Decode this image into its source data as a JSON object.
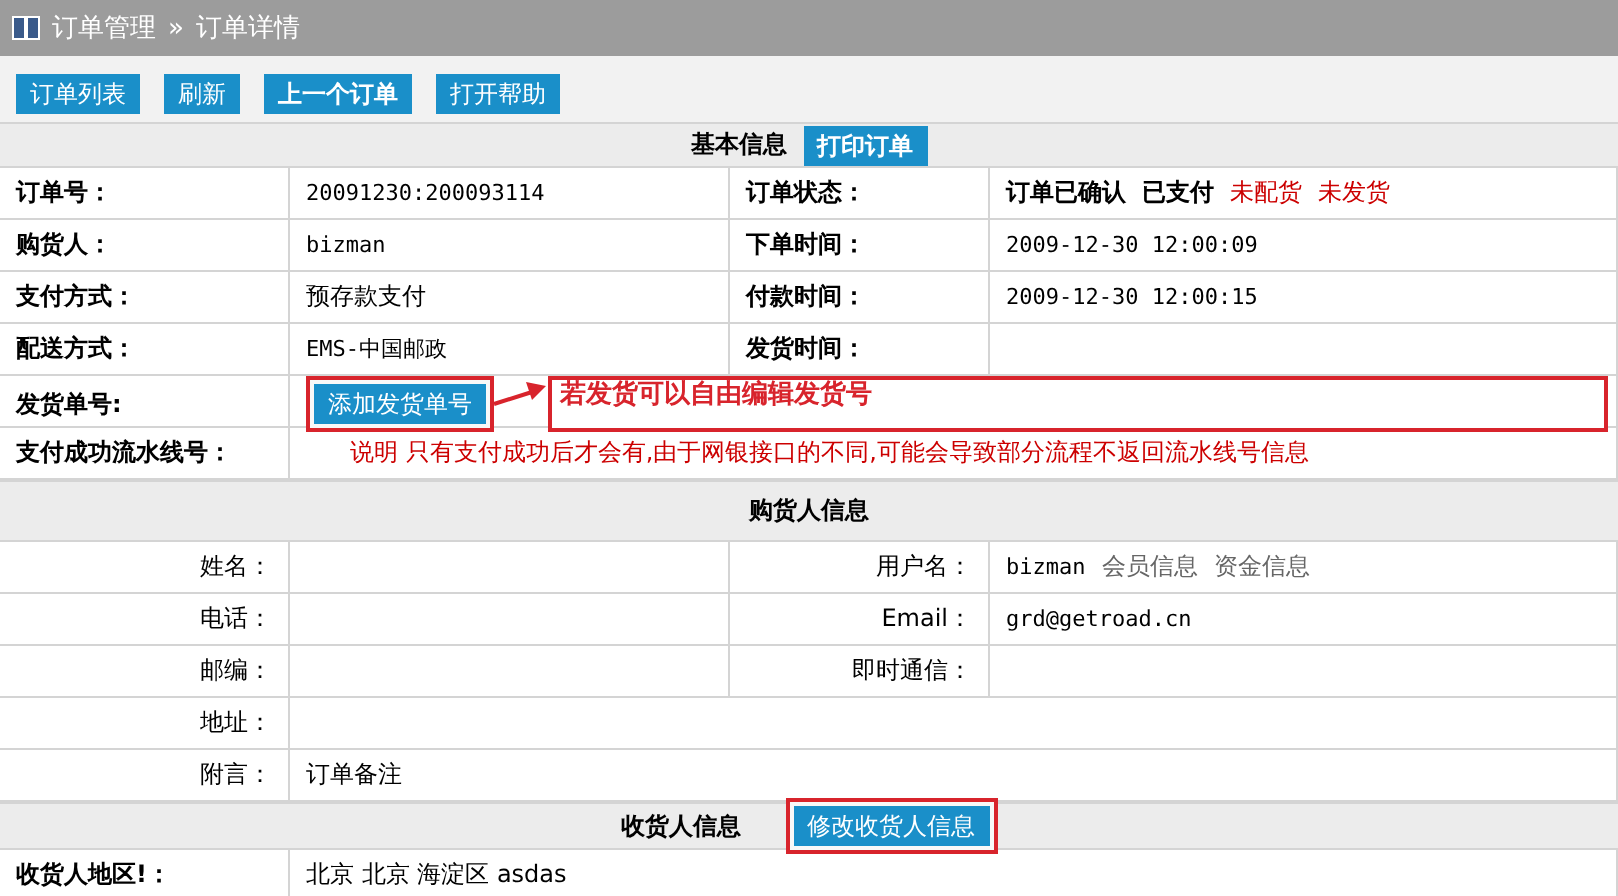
{
  "breadcrumb": {
    "section": "订单管理",
    "separator": "»",
    "page": "订单详情"
  },
  "toolbar": [
    {
      "label": "订单列表",
      "bold": false
    },
    {
      "label": "刷新",
      "bold": false
    },
    {
      "label": "上一个订单",
      "bold": true
    },
    {
      "label": "打开帮助",
      "bold": false
    }
  ],
  "basic_info": {
    "title": "基本信息",
    "button": "打印订单",
    "rows": [
      {
        "kind": "pair",
        "label": "订单号：",
        "value": "20091230:200093114",
        "label2": "订单状态：",
        "status": [
          {
            "text": "订单已确认",
            "color": "#000000"
          },
          {
            "text": "已支付",
            "color": "#000000"
          },
          {
            "text": "未配货",
            "color": "#cc0000"
          },
          {
            "text": "未发货",
            "color": "#cc0000"
          }
        ]
      },
      {
        "kind": "pair",
        "label": "购货人：",
        "value": "bizman",
        "label2": "下单时间：",
        "value2": "2009-12-30 12:00:09"
      },
      {
        "kind": "pair",
        "label": "支付方式：",
        "value": "预存款支付",
        "label2": "付款时间：",
        "value2": "2009-12-30 12:00:15"
      },
      {
        "kind": "pair",
        "label": "配送方式：",
        "value": "EMS-中国邮政",
        "label2": "发货时间："
      },
      {
        "kind": "button",
        "label": "发货单号:",
        "button": "添加发货单号",
        "highlighted": true
      },
      {
        "kind": "note",
        "label": "支付成功流水线号：",
        "note": "说明 只有支付成功后才会有,由于网银接口的不同,可能会导致部分流程不返回流水线号信息"
      }
    ]
  },
  "callout": "若发货可以自由编辑发货号",
  "buyer_info": {
    "title": "购货人信息",
    "rows": [
      {
        "label": "姓名：",
        "label2": "用户名：",
        "value2": "bizman",
        "links": [
          "会员信息",
          "资金信息"
        ]
      },
      {
        "label": "电话：",
        "label2": "Email：",
        "value2": "grd@getroad.cn"
      },
      {
        "label": "邮编：",
        "label2": "即时通信："
      },
      {
        "label": "地址："
      },
      {
        "label": "附言：",
        "value": "订单备注"
      }
    ]
  },
  "receiver_info": {
    "title": "收货人信息",
    "button": "修改收货人信息",
    "highlighted": true,
    "rows": [
      {
        "label": "收货人地区!：",
        "value": "北京 北京 海淀区 asdas"
      }
    ]
  }
}
